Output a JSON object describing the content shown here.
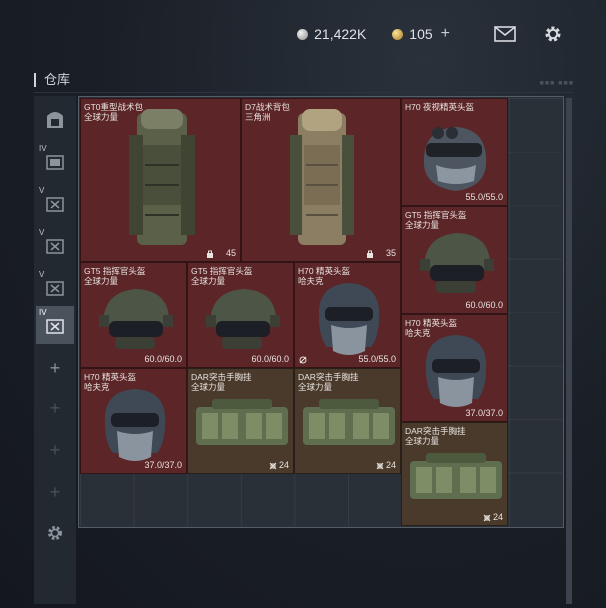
{
  "currency": {
    "silver": "21,422K",
    "gold": "105",
    "gold_plus": "+"
  },
  "header": {
    "title": "仓库",
    "tag": "■■■ ■■■"
  },
  "side_tabs": {
    "tab_labels": [
      "IV",
      "V",
      "V",
      "V",
      "IV"
    ],
    "add": "+"
  },
  "items": [
    {
      "name_line1": "GT0重型战术包",
      "name_line2": "全球力量",
      "value": "45"
    },
    {
      "name_line1": "D7战术背包",
      "name_line2": "三角洲",
      "value": "35"
    },
    {
      "name_line1": "H70 夜视精英头盔",
      "name_line2": "",
      "value": "55.0/55.0"
    },
    {
      "name_line1": "GT5 指挥官头盔",
      "name_line2": "全球力量",
      "value": "60.0/60.0"
    },
    {
      "name_line1": "GT5 指挥官头盔",
      "name_line2": "全球力量",
      "value": "60.0/60.0"
    },
    {
      "name_line1": "GT5 指挥官头盔",
      "name_line2": "全球力量",
      "value": "60.0/60.0"
    },
    {
      "name_line1": "H70 精英头盔",
      "name_line2": "哈夫克",
      "value": "55.0/55.0"
    },
    {
      "name_line1": "H70 精英头盔",
      "name_line2": "哈夫克",
      "value": "37.0/37.0"
    },
    {
      "name_line1": "H70 精英头盔",
      "name_line2": "哈夫克",
      "value": "37.0/37.0"
    },
    {
      "name_line1": "DAR突击手胸挂",
      "name_line2": "全球力量",
      "value": "24"
    },
    {
      "name_line1": "DAR突击手胸挂",
      "name_line2": "全球力量",
      "value": "24"
    },
    {
      "name_line1": "DAR突击手胸挂",
      "name_line2": "全球力量",
      "value": "24"
    }
  ],
  "colors": {
    "item_red": "#5c2528",
    "item_brown": "#4a3a2c",
    "panel_border": "#545c66"
  }
}
